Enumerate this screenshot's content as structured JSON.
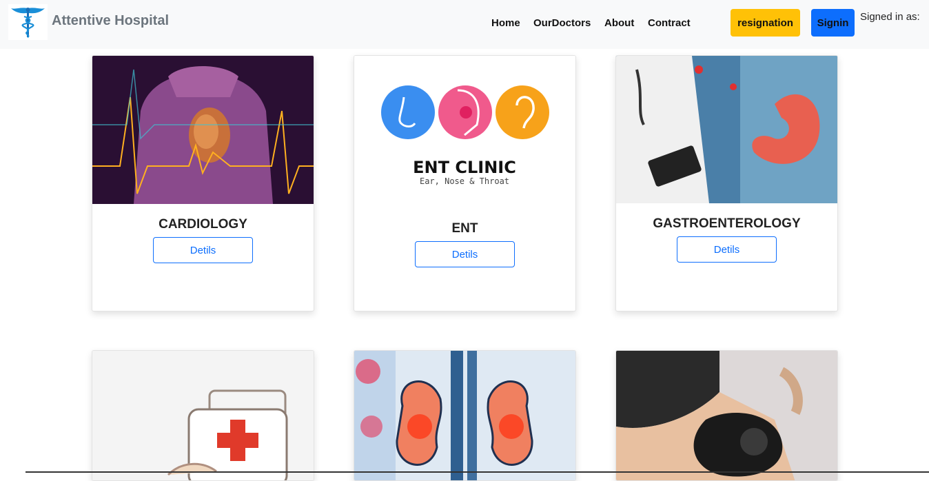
{
  "navbar": {
    "brand": "Attentive Hospital",
    "logo_icon": "caduceus-icon",
    "links": [
      {
        "label": "Home"
      },
      {
        "label": "OurDoctors"
      },
      {
        "label": "About"
      },
      {
        "label": "Contract"
      }
    ],
    "resignation_label": "resignation",
    "signin_label": "Signin",
    "signed_in_text": "Signed in as:",
    "colors": {
      "yellow": "#ffc107",
      "blue": "#0d6efd"
    }
  },
  "departments": [
    {
      "title": "CARDIOLOGY",
      "button": "Detils",
      "image": "heart-illustration"
    },
    {
      "title": "ENT",
      "button": "Detils",
      "image": "ent-clinic-logo",
      "image_text": {
        "heading": "ENT CLINIC",
        "sub": "Ear, Nose & Throat"
      }
    },
    {
      "title": "GASTROENTEROLOGY",
      "button": "Detils",
      "image": "stomach-illustration"
    },
    {
      "title": "",
      "button": "",
      "image": "first-aid-kit-illustration"
    },
    {
      "title": "",
      "button": "",
      "image": "kidney-illustration"
    },
    {
      "title": "",
      "button": "",
      "image": "knee-brace-photo"
    }
  ]
}
